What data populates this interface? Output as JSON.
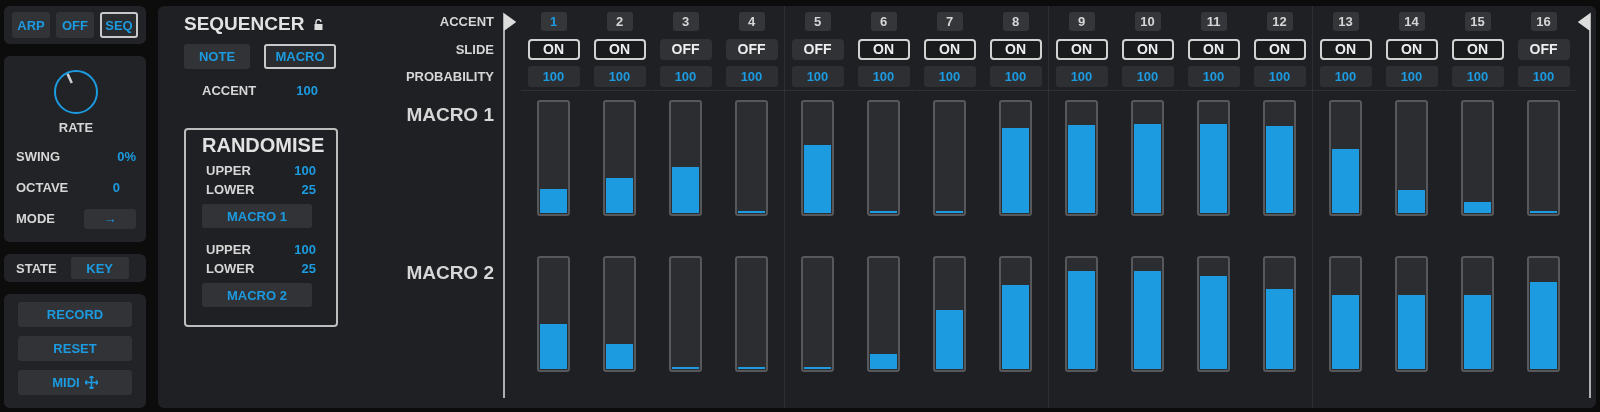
{
  "mode_buttons": [
    {
      "label": "ARP",
      "selected": false
    },
    {
      "label": "OFF",
      "selected": false
    },
    {
      "label": "SEQ",
      "selected": true
    }
  ],
  "rate": {
    "label": "RATE"
  },
  "params": [
    {
      "label": "SWING",
      "value": "0%",
      "kind": "text"
    },
    {
      "label": "OCTAVE",
      "value": "0",
      "kind": "text"
    },
    {
      "label": "MODE",
      "value": "→",
      "kind": "button"
    }
  ],
  "state": {
    "label": "STATE",
    "value": "KEY"
  },
  "actions": [
    {
      "label": "RECORD",
      "kind": "text"
    },
    {
      "label": "RESET",
      "kind": "text"
    },
    {
      "label": "MIDI",
      "kind": "move"
    }
  ],
  "sequencer": {
    "title": "SEQUENCER",
    "views": [
      {
        "label": "NOTE",
        "selected": false
      },
      {
        "label": "MACRO",
        "selected": true
      }
    ],
    "accent": {
      "label": "ACCENT",
      "value": "100"
    },
    "randomise": {
      "title": "RANDOMISE",
      "groups": [
        {
          "upper_label": "UPPER",
          "upper": "100",
          "lower_label": "LOWER",
          "lower": "25",
          "button": "MACRO 1"
        },
        {
          "upper_label": "UPPER",
          "upper": "100",
          "lower_label": "LOWER",
          "lower": "25",
          "button": "MACRO 2"
        }
      ]
    }
  },
  "row_labels": [
    "ACCENT",
    "SLIDE",
    "PROBABILITY"
  ],
  "macro_labels": [
    "MACRO 1",
    "MACRO 2"
  ],
  "steps": [
    {
      "number": "1",
      "selected": true,
      "slide": {
        "label": "ON",
        "on": true
      },
      "probability": "100",
      "macros": [
        {
          "level": 0.22
        },
        {
          "level": 0.41
        }
      ]
    },
    {
      "number": "2",
      "selected": false,
      "slide": {
        "label": "ON",
        "on": true
      },
      "probability": "100",
      "macros": [
        {
          "level": 0.32
        },
        {
          "level": 0.23
        }
      ]
    },
    {
      "number": "3",
      "selected": false,
      "slide": {
        "label": "OFF",
        "on": false
      },
      "probability": "100",
      "macros": [
        {
          "level": 0.42
        },
        {
          "level": 0
        }
      ]
    },
    {
      "number": "4",
      "selected": false,
      "slide": {
        "label": "OFF",
        "on": false
      },
      "probability": "100",
      "macros": [
        {
          "level": 0
        },
        {
          "level": 0
        }
      ]
    },
    {
      "number": "5",
      "selected": false,
      "slide": {
        "label": "OFF",
        "on": false
      },
      "probability": "100",
      "macros": [
        {
          "level": 0.62
        },
        {
          "level": 0
        }
      ]
    },
    {
      "number": "6",
      "selected": false,
      "slide": {
        "label": "ON",
        "on": true
      },
      "probability": "100",
      "macros": [
        {
          "level": 0
        },
        {
          "level": 0.14
        }
      ]
    },
    {
      "number": "7",
      "selected": false,
      "slide": {
        "label": "ON",
        "on": true
      },
      "probability": "100",
      "macros": [
        {
          "level": 0
        },
        {
          "level": 0.54
        }
      ]
    },
    {
      "number": "8",
      "selected": false,
      "slide": {
        "label": "ON",
        "on": true
      },
      "probability": "100",
      "macros": [
        {
          "level": 0.77
        },
        {
          "level": 0.76
        }
      ]
    },
    {
      "number": "9",
      "selected": false,
      "slide": {
        "label": "ON",
        "on": true
      },
      "probability": "100",
      "macros": [
        {
          "level": 0.8
        },
        {
          "level": 0.89
        }
      ]
    },
    {
      "number": "10",
      "selected": false,
      "slide": {
        "label": "ON",
        "on": true
      },
      "probability": "100",
      "macros": [
        {
          "level": 0.81
        },
        {
          "level": 0.89
        }
      ]
    },
    {
      "number": "11",
      "selected": false,
      "slide": {
        "label": "ON",
        "on": true
      },
      "probability": "100",
      "macros": [
        {
          "level": 0.81
        },
        {
          "level": 0.85
        }
      ]
    },
    {
      "number": "12",
      "selected": false,
      "slide": {
        "label": "ON",
        "on": true
      },
      "probability": "100",
      "macros": [
        {
          "level": 0.79
        },
        {
          "level": 0.73
        }
      ]
    },
    {
      "number": "13",
      "selected": false,
      "slide": {
        "label": "ON",
        "on": true
      },
      "probability": "100",
      "macros": [
        {
          "level": 0.58
        },
        {
          "level": 0.67
        }
      ]
    },
    {
      "number": "14",
      "selected": false,
      "slide": {
        "label": "ON",
        "on": true
      },
      "probability": "100",
      "macros": [
        {
          "level": 0.21
        },
        {
          "level": 0.67
        }
      ]
    },
    {
      "number": "15",
      "selected": false,
      "slide": {
        "label": "ON",
        "on": true
      },
      "probability": "100",
      "macros": [
        {
          "level": 0.1
        },
        {
          "level": 0.67
        }
      ]
    },
    {
      "number": "16",
      "selected": false,
      "slide": {
        "label": "OFF",
        "on": false
      },
      "probability": "100",
      "macros": [
        {
          "level": 0
        },
        {
          "level": 0.79
        }
      ]
    }
  ]
}
